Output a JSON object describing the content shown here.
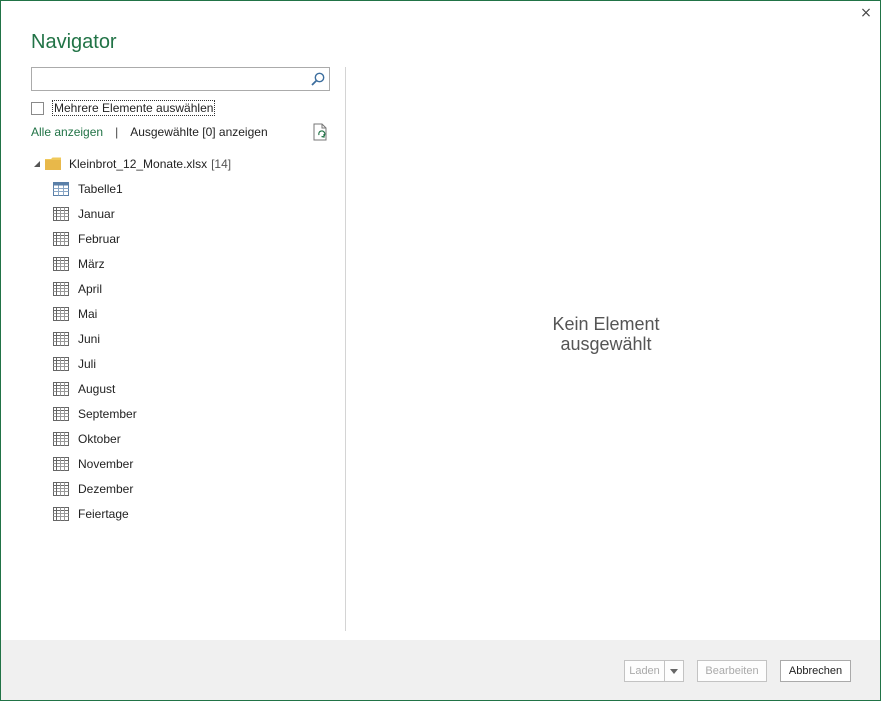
{
  "window": {
    "title": "Navigator",
    "close_glyph": "×"
  },
  "search": {
    "value": "",
    "placeholder": "",
    "icon": "search-icon"
  },
  "multi_select": {
    "label": "Mehrere Elemente auswählen",
    "checked": false
  },
  "links": {
    "show_all": "Alle anzeigen",
    "separator": "|",
    "show_selected": "Ausgewählte [0] anzeigen"
  },
  "tree": {
    "root": {
      "name": "Kleinbrot_12_Monate.xlsx",
      "count": "[14]",
      "icon": "folder-icon"
    },
    "items": [
      {
        "label": "Tabelle1",
        "icon": "table-icon"
      },
      {
        "label": "Januar",
        "icon": "sheet-icon"
      },
      {
        "label": "Februar",
        "icon": "sheet-icon"
      },
      {
        "label": "März",
        "icon": "sheet-icon"
      },
      {
        "label": "April",
        "icon": "sheet-icon"
      },
      {
        "label": "Mai",
        "icon": "sheet-icon"
      },
      {
        "label": "Juni",
        "icon": "sheet-icon"
      },
      {
        "label": "Juli",
        "icon": "sheet-icon"
      },
      {
        "label": "August",
        "icon": "sheet-icon"
      },
      {
        "label": "September",
        "icon": "sheet-icon"
      },
      {
        "label": "Oktober",
        "icon": "sheet-icon"
      },
      {
        "label": "November",
        "icon": "sheet-icon"
      },
      {
        "label": "Dezember",
        "icon": "sheet-icon"
      },
      {
        "label": "Feiertage",
        "icon": "sheet-icon"
      }
    ]
  },
  "preview": {
    "empty_line1": "Kein Element",
    "empty_line2": "ausgewählt"
  },
  "footer": {
    "load_label": "Laden",
    "edit_label": "Bearbeiten",
    "cancel_label": "Abbrechen"
  },
  "colors": {
    "accent": "#217346",
    "footer_bg": "#f0f0f0",
    "divider": "#d4d4d4"
  }
}
